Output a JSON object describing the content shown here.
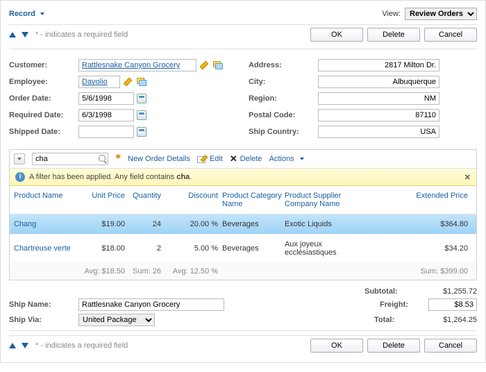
{
  "menu": {
    "record": "Record"
  },
  "view": {
    "label": "View:",
    "selected": "Review Orders"
  },
  "buttons": {
    "ok": "OK",
    "delete": "Delete",
    "cancel": "Cancel"
  },
  "required_note": "* - indicates a required field",
  "labels": {
    "customer": "Customer:",
    "employee": "Employee:",
    "orderDate": "Order Date:",
    "requiredDate": "Required Date:",
    "shippedDate": "Shipped Date:",
    "address": "Address:",
    "city": "City:",
    "region": "Region:",
    "postal": "Postal Code:",
    "country": "Ship Country:",
    "shipName": "Ship Name:",
    "shipVia": "Ship Via:"
  },
  "values": {
    "customer": "Rattlesnake Canyon Grocery",
    "employee": "Davolio",
    "orderDate": "5/6/1998",
    "requiredDate": "6/3/1998",
    "shippedDate": "",
    "address": "2817 Milton Dr.",
    "city": "Albuquerque",
    "region": "NM",
    "postal": "87110",
    "country": "USA",
    "shipName": "Rattlesnake Canyon Grocery",
    "shipVia": "United Package"
  },
  "grid": {
    "searchValue": "cha",
    "toolbar": {
      "new": "New Order Details",
      "edit": "Edit",
      "delete": "Delete",
      "actions": "Actions"
    },
    "filterMsgA": "A filter has been applied. Any field contains ",
    "filterMsgB": "cha",
    "filterMsgC": ".",
    "headers": {
      "prod": "Product Name",
      "uprice": "Unit Price",
      "qty": "Quantity",
      "disc": "Discount",
      "cat": "Product Category Name",
      "sup": "Product Supplier Company Name",
      "ext": "Extended Price"
    },
    "rows": [
      {
        "prod": "Chang",
        "uprice": "$19.00",
        "qty": "24",
        "disc": "20.00 %",
        "cat": "Beverages",
        "sup": "Exotic Liquids",
        "ext": "$364.80"
      },
      {
        "prod": "Chartreuse verte",
        "uprice": "$18.00",
        "qty": "2",
        "disc": "5.00 %",
        "cat": "Beverages",
        "sup": "Aux joyeux ecclésiastiques",
        "ext": "$34.20"
      }
    ],
    "footer": {
      "avgPrice": "Avg: $18.50",
      "sumQty": "Sum: 26",
      "avgDisc": "Avg: 12.50 %",
      "sumExt": "Sum: $399.00"
    }
  },
  "totals": {
    "subtotalLabel": "Subtotal:",
    "subtotal": "$1,255.72",
    "freightLabel": "Freight:",
    "freight": "$8.53",
    "totalLabel": "Total:",
    "total": "$1,264.25"
  }
}
